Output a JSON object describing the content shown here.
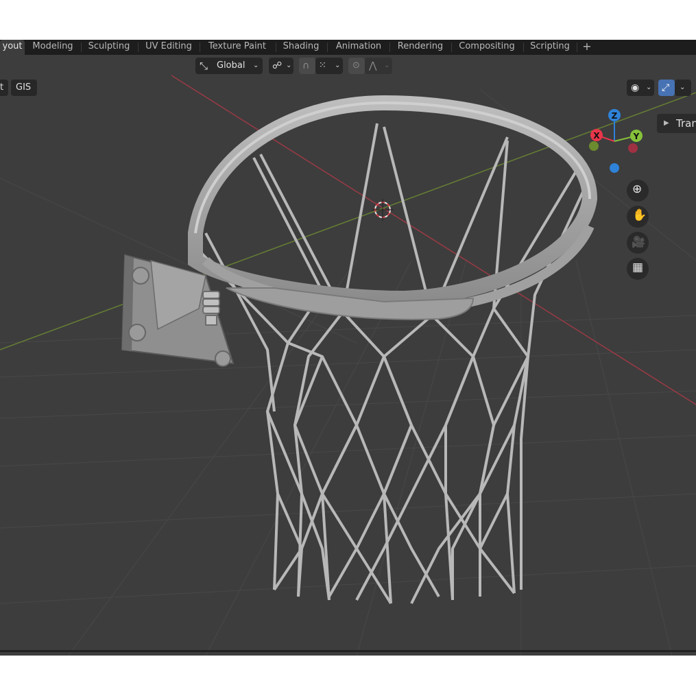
{
  "workspace_tabs": [
    {
      "label": "yout",
      "active": true
    },
    {
      "label": "Modeling"
    },
    {
      "label": "Sculpting"
    },
    {
      "label": "UV Editing"
    },
    {
      "label": "Texture Paint"
    },
    {
      "label": "Shading"
    },
    {
      "label": "Animation"
    },
    {
      "label": "Rendering"
    },
    {
      "label": "Compositing"
    },
    {
      "label": "Scripting"
    }
  ],
  "add_workspace_label": "+",
  "header": {
    "transform_orientation": "Global",
    "pivot_icon": "transform-pivot-icon",
    "snap_icon": "magnet-snap-icon",
    "snap_target_icon": "snap-grid-icon",
    "proportional_icon": "proportional-edit-icon",
    "falloff_icon": "falloff-curve-icon"
  },
  "left_header": {
    "cut_label": "t",
    "gis_label": "GIS"
  },
  "right_header": {
    "visibility_icon": "eye-visibility-icon",
    "gizmo_icon": "gizmo-toggle-icon"
  },
  "sidebar_tab_label": "Tran",
  "nav_gizmo": {
    "x_label": "X",
    "y_label": "Y",
    "z_label": "Z",
    "colors": {
      "x": "#e8364a",
      "y": "#86c13a",
      "z": "#2e82d9"
    }
  },
  "nav_tools": [
    {
      "name": "zoom-icon"
    },
    {
      "name": "hand-pan-icon"
    },
    {
      "name": "camera-view-icon"
    },
    {
      "name": "ortho-grid-icon"
    }
  ],
  "theme": {
    "viewport_bg": "#3d3d3d",
    "accent": "#4772b3"
  }
}
